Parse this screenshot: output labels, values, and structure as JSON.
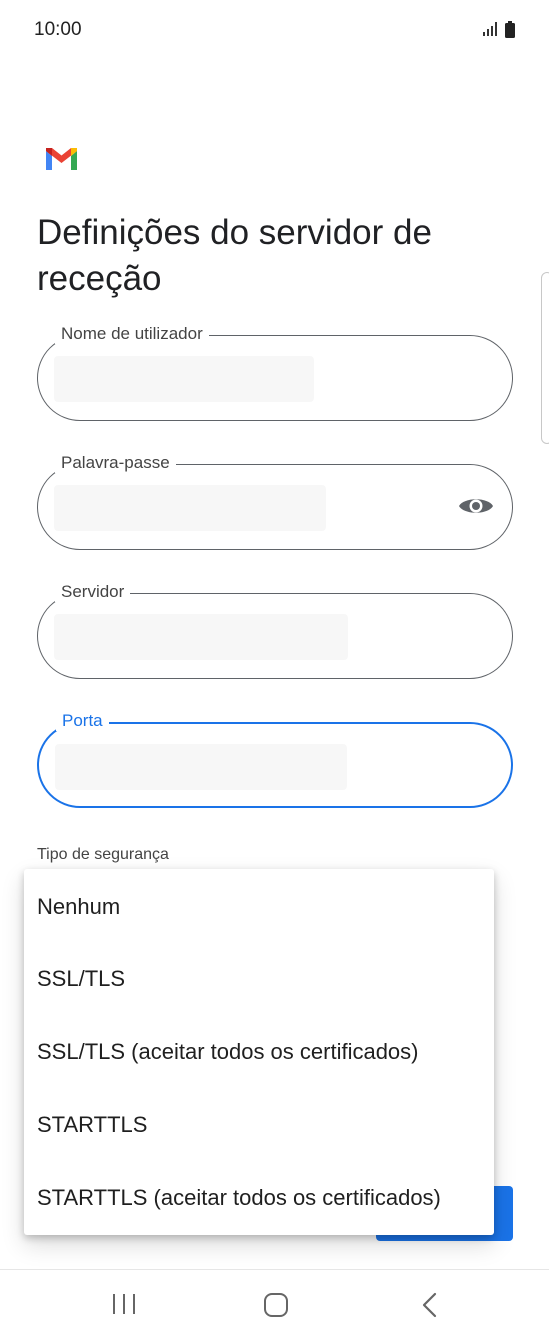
{
  "status_bar": {
    "time": "10:00"
  },
  "page": {
    "title": "Definições do servidor de receção"
  },
  "fields": {
    "username": {
      "label": "Nome de utilizador",
      "value": ""
    },
    "password": {
      "label": "Palavra-passe",
      "value": ""
    },
    "server": {
      "label": "Servidor",
      "value": ""
    },
    "port": {
      "label": "Porta",
      "value": ""
    }
  },
  "security": {
    "label": "Tipo de segurança",
    "options": [
      "Nenhum",
      "SSL/TLS",
      "SSL/TLS (aceitar todos os certificados)",
      "STARTTLS",
      "STARTTLS (aceitar todos os certificados)"
    ]
  },
  "icons": {
    "logo": "gmail-logo",
    "password_toggle": "eye-icon",
    "nav": [
      "recents-icon",
      "home-icon",
      "back-icon"
    ]
  },
  "colors": {
    "accent": "#1a73e8",
    "outline": "#5f6368"
  }
}
